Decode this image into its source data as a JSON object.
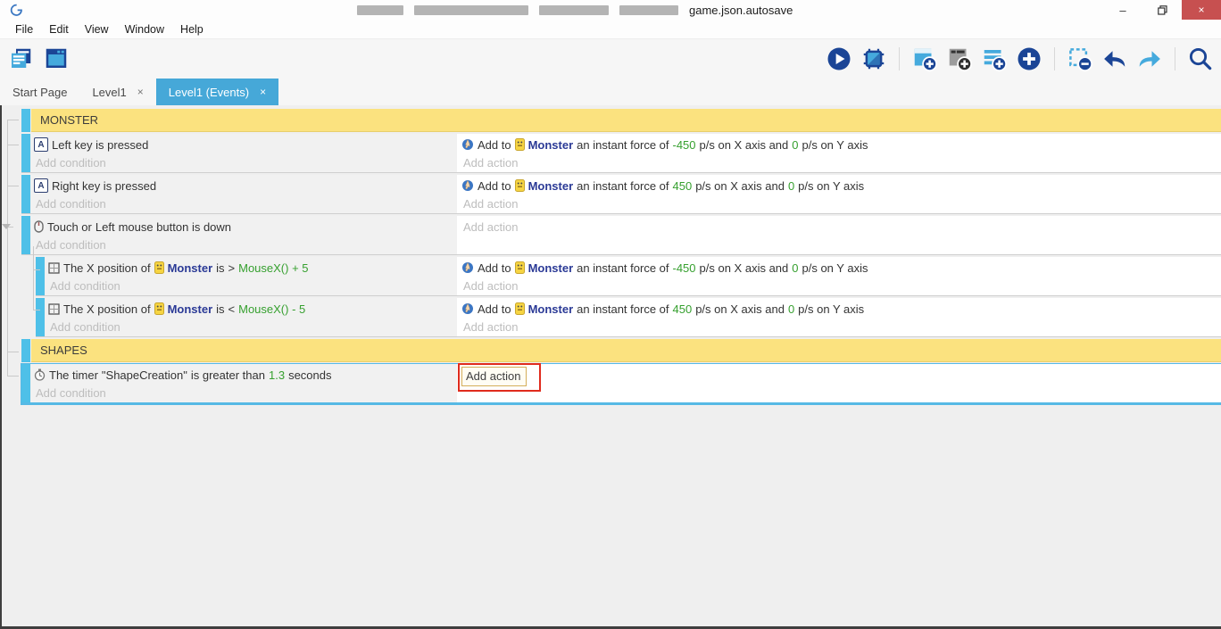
{
  "window": {
    "title_visible_text": "game.json.autosave",
    "title_redacted_blocks": 4,
    "controls": {
      "minimize": "–",
      "restore": "restore",
      "close": "×"
    }
  },
  "menu_bar": {
    "items": [
      "File",
      "Edit",
      "View",
      "Window",
      "Help"
    ]
  },
  "toolbar": {
    "left_icons": [
      "project-manager-icon",
      "scene-editor-icon"
    ],
    "right_icons": [
      "play-icon",
      "debug-icon",
      "separator",
      "add-event-icon",
      "add-subevent-icon",
      "add-comment-icon",
      "add-circle-icon",
      "separator",
      "deselect-icon",
      "undo-icon",
      "redo-icon",
      "separator",
      "search-icon"
    ]
  },
  "tabs": [
    {
      "label": "Start Page",
      "active": false,
      "closable": false
    },
    {
      "label": "Level1",
      "active": false,
      "closable": true,
      "close_glyph": "×"
    },
    {
      "label": "Level1 (Events)",
      "active": true,
      "closable": true,
      "close_glyph": "×"
    }
  ],
  "colors": {
    "active_tab": "#46a8d8",
    "section_header_yellow": "#fbe27f",
    "event_bar_blue": "#4ec0e8",
    "value_green": "#36a02f",
    "object_navy": "#2b3a96",
    "placeholder_gray": "#bdbdbd",
    "close_button_red": "#c75050",
    "annotation_red": "#e02b1d",
    "selected_border_blue": "#56b9e5"
  },
  "sheet": {
    "sections": [
      {
        "title": "MONSTER",
        "events": [
          {
            "indent": 0,
            "cond_lines": [
              [
                {
                  "icon": "keyboard-icon"
                },
                {
                  "t": "Left key is pressed",
                  "c": "plain"
                }
              ]
            ],
            "act_lines": [
              [
                {
                  "icon": "force-icon"
                },
                {
                  "t": "Add to ",
                  "c": "plain"
                },
                {
                  "icon": "monster-icon"
                },
                {
                  "t": "Monster",
                  "c": "obj"
                },
                {
                  "t": " an instant force of ",
                  "c": "plain"
                },
                {
                  "t": "-450",
                  "c": "green"
                },
                {
                  "t": " p/s on X axis and ",
                  "c": "plain"
                },
                {
                  "t": "0",
                  "c": "green"
                },
                {
                  "t": " p/s on Y axis",
                  "c": "plain"
                }
              ]
            ],
            "add_condition": "Add condition",
            "add_action": "Add action"
          },
          {
            "indent": 0,
            "cond_lines": [
              [
                {
                  "icon": "keyboard-icon"
                },
                {
                  "t": "Right key is pressed",
                  "c": "plain"
                }
              ]
            ],
            "act_lines": [
              [
                {
                  "icon": "force-icon"
                },
                {
                  "t": "Add to ",
                  "c": "plain"
                },
                {
                  "icon": "monster-icon"
                },
                {
                  "t": "Monster",
                  "c": "obj"
                },
                {
                  "t": " an instant force of ",
                  "c": "plain"
                },
                {
                  "t": "450",
                  "c": "green"
                },
                {
                  "t": " p/s on X axis and ",
                  "c": "plain"
                },
                {
                  "t": "0",
                  "c": "green"
                },
                {
                  "t": " p/s on Y axis",
                  "c": "plain"
                }
              ]
            ],
            "add_condition": "Add condition",
            "add_action": "Add action"
          },
          {
            "indent": 0,
            "has_expander": true,
            "cond_lines": [
              [
                {
                  "icon": "mouse-icon"
                },
                {
                  "t": "Touch or ",
                  "c": "plain"
                },
                {
                  "t": "Left",
                  "c": "plain"
                },
                {
                  "t": " mouse button is down",
                  "c": "plain"
                }
              ]
            ],
            "act_lines": [],
            "add_condition": "Add condition",
            "add_action": "Add action"
          },
          {
            "indent": 1,
            "cond_lines": [
              [
                {
                  "icon": "position-icon"
                },
                {
                  "t": "The X position of ",
                  "c": "plain"
                },
                {
                  "icon": "monster-icon"
                },
                {
                  "t": "Monster",
                  "c": "obj"
                },
                {
                  "t": " is ",
                  "c": "plain"
                },
                {
                  "t": "> ",
                  "c": "plain"
                },
                {
                  "t": "MouseX() + 5",
                  "c": "green"
                }
              ]
            ],
            "act_lines": [
              [
                {
                  "icon": "force-icon"
                },
                {
                  "t": "Add to ",
                  "c": "plain"
                },
                {
                  "icon": "monster-icon"
                },
                {
                  "t": "Monster",
                  "c": "obj"
                },
                {
                  "t": " an instant force of ",
                  "c": "plain"
                },
                {
                  "t": "-450",
                  "c": "green"
                },
                {
                  "t": " p/s on X axis and ",
                  "c": "plain"
                },
                {
                  "t": "0",
                  "c": "green"
                },
                {
                  "t": " p/s on Y axis",
                  "c": "plain"
                }
              ]
            ],
            "add_condition": "Add condition",
            "add_action": "Add action"
          },
          {
            "indent": 1,
            "cond_lines": [
              [
                {
                  "icon": "position-icon"
                },
                {
                  "t": "The X position of ",
                  "c": "plain"
                },
                {
                  "icon": "monster-icon"
                },
                {
                  "t": "Monster",
                  "c": "obj"
                },
                {
                  "t": " is ",
                  "c": "plain"
                },
                {
                  "t": "< ",
                  "c": "plain"
                },
                {
                  "t": "MouseX() - 5",
                  "c": "green"
                }
              ]
            ],
            "act_lines": [
              [
                {
                  "icon": "force-icon"
                },
                {
                  "t": "Add to ",
                  "c": "plain"
                },
                {
                  "icon": "monster-icon"
                },
                {
                  "t": "Monster",
                  "c": "obj"
                },
                {
                  "t": " an instant force of ",
                  "c": "plain"
                },
                {
                  "t": "450",
                  "c": "green"
                },
                {
                  "t": " p/s on X axis and ",
                  "c": "plain"
                },
                {
                  "t": "0",
                  "c": "green"
                },
                {
                  "t": " p/s on Y axis",
                  "c": "plain"
                }
              ]
            ],
            "add_condition": "Add condition",
            "add_action": "Add action"
          }
        ]
      },
      {
        "title": "SHAPES",
        "events": [
          {
            "indent": 0,
            "selected": true,
            "cond_lines": [
              [
                {
                  "icon": "timer-icon"
                },
                {
                  "t": "The timer ",
                  "c": "plain"
                },
                {
                  "t": "\"ShapeCreation\"",
                  "c": "plain"
                },
                {
                  "t": " is greater than ",
                  "c": "plain"
                },
                {
                  "t": "1.3",
                  "c": "green"
                },
                {
                  "t": " seconds",
                  "c": "plain"
                }
              ]
            ],
            "act_lines": [],
            "add_condition": "Add condition",
            "add_action": "Add action",
            "add_action_focused": true,
            "add_action_annotated": true
          }
        ]
      }
    ]
  }
}
